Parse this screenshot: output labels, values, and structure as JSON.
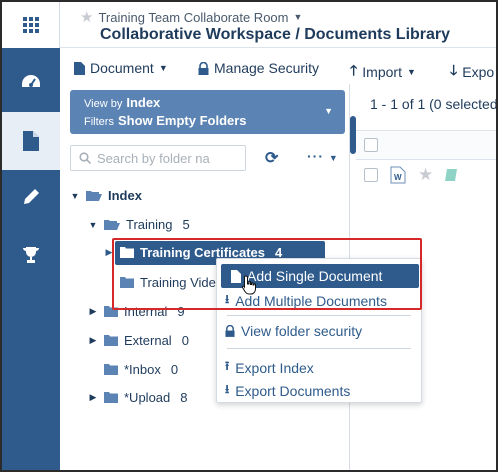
{
  "header": {
    "room_name": "Training Team Collaborate Room",
    "breadcrumb": "Collaborative Workspace / Documents Library"
  },
  "toolbar": {
    "document_label": "Document",
    "manage_security_label": "Manage Security",
    "import_label": "Import",
    "export_label": "Expo"
  },
  "view_box": {
    "view_by_label": "View by",
    "view_by_value": "Index",
    "filters_label": "Filters",
    "filters_value": "Show Empty Folders"
  },
  "search": {
    "placeholder": "Search by folder na"
  },
  "tree": {
    "root": {
      "label": "Index"
    },
    "training": {
      "label": "Training",
      "count": "5"
    },
    "training_certificates": {
      "label": "Training Certificates",
      "count": "4"
    },
    "training_videos": {
      "label": "Training Vide"
    },
    "internal": {
      "label": "Internal",
      "count": "9"
    },
    "external": {
      "label": "External",
      "count": "0"
    },
    "inbox": {
      "label": "*Inbox",
      "count": "0"
    },
    "upload": {
      "label": "*Upload",
      "count": "8"
    }
  },
  "results": {
    "summary": "1 - 1 of 1 (0 selected"
  },
  "context_menu": {
    "add_single": "Add Single Document",
    "add_multiple": "Add Multiple Documents",
    "view_security": "View folder security",
    "export_index": "Export Index",
    "export_documents": "Export Documents"
  },
  "colors": {
    "rail": "#2f5b8c",
    "view_box": "#5b84b5",
    "highlight": "#2f5b8c",
    "callout": "#d62828"
  }
}
